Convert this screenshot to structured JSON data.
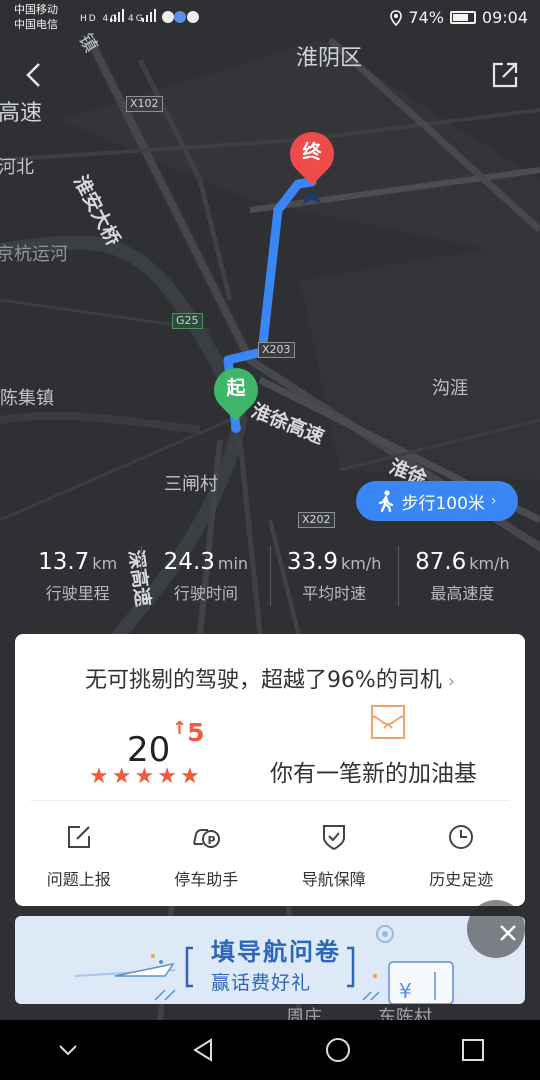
{
  "status_bar": {
    "carrier1": "中国移动",
    "carrier2": "中国电信",
    "battery": "74%",
    "battery_level": 0.74,
    "time": "09:04"
  },
  "map": {
    "labels": {
      "district": "淮阴区",
      "gaosu_left": "高速",
      "hebei": "河北",
      "huaian_bridge": "淮安大桥",
      "grand_canal": "京杭运河",
      "chenji": "陈集镇",
      "gouya": "沟涯",
      "huaixu_highway": "淮徐高速",
      "sanzha": "三闸村",
      "huai_right": "淮徐",
      "zhouzhuang": "周庄",
      "dongchen": "东陈村",
      "shensu": "深高速",
      "zhen": "镇"
    },
    "badges": {
      "x102": "X102",
      "g25": "G25",
      "x203": "X203",
      "x202": "X202"
    },
    "start_pin": "起",
    "end_pin": "终"
  },
  "walk_button": {
    "label": "步行100米"
  },
  "stats": [
    {
      "value": "13.7",
      "unit": "km",
      "label": "行驶里程"
    },
    {
      "value": "24.3",
      "unit": "min",
      "label": "行驶时间"
    },
    {
      "value": "33.9",
      "unit": "km/h",
      "label": "平均时速"
    },
    {
      "value": "87.6",
      "unit": "km/h",
      "label": "最高速度"
    }
  ],
  "card": {
    "headline": "无可挑剔的驾驶，超越了96%的司机",
    "score": "20",
    "score_up": "5",
    "stars": 5,
    "fuel_text": "你有一笔新的加油基",
    "tools": [
      {
        "label": "问题上报",
        "icon": "edit-icon"
      },
      {
        "label": "停车助手",
        "icon": "parking-icon"
      },
      {
        "label": "导航保障",
        "icon": "shield-check-icon"
      },
      {
        "label": "历史足迹",
        "icon": "clock-icon"
      }
    ]
  },
  "banner": {
    "title": "填导航问卷",
    "subtitle": "赢话费好礼"
  },
  "colors": {
    "route": "#3a86f5",
    "start_pin": "#3fb56a",
    "end_pin": "#f04b4b",
    "accent": "#f15a3a"
  }
}
